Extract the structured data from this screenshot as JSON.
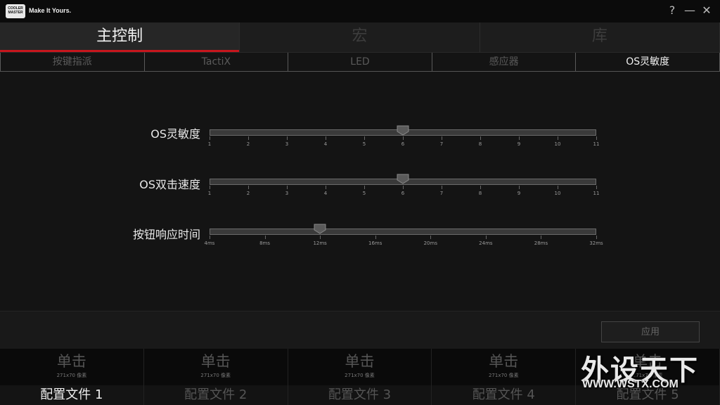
{
  "brand": {
    "logo_text": "COOLER MASTER",
    "tagline": "Make It Yours."
  },
  "window_controls": {
    "help": "?",
    "minimize": "—",
    "close": "✕"
  },
  "main_tabs": [
    {
      "label": "主控制",
      "active": true
    },
    {
      "label": "宏",
      "active": false
    },
    {
      "label": "库",
      "active": false
    }
  ],
  "sub_tabs": [
    {
      "label": "按键指派",
      "active": false
    },
    {
      "label": "TactiX",
      "active": false
    },
    {
      "label": "LED",
      "active": false
    },
    {
      "label": "感应器",
      "active": false
    },
    {
      "label": "OS灵敏度",
      "active": true
    }
  ],
  "sliders": [
    {
      "label": "OS灵敏度",
      "ticks": [
        "1",
        "2",
        "3",
        "4",
        "5",
        "6",
        "7",
        "8",
        "9",
        "10",
        "11"
      ],
      "value_index": 5
    },
    {
      "label": "OS双击速度",
      "ticks": [
        "1",
        "2",
        "3",
        "4",
        "5",
        "6",
        "7",
        "8",
        "9",
        "10",
        "11"
      ],
      "value_index": 5
    },
    {
      "label": "按钮响应时间",
      "ticks": [
        "4ms",
        "8ms",
        "12ms",
        "16ms",
        "20ms",
        "24ms",
        "28ms",
        "32ms"
      ],
      "value_index": 2
    }
  ],
  "apply_label": "应用",
  "profiles": [
    {
      "click_label": "单击",
      "resolution": "271x70 像素",
      "name": "配置文件 1",
      "active": true
    },
    {
      "click_label": "单击",
      "resolution": "271x70 像素",
      "name": "配置文件 2",
      "active": false
    },
    {
      "click_label": "单击",
      "resolution": "271x70 像素",
      "name": "配置文件 3",
      "active": false
    },
    {
      "click_label": "单击",
      "resolution": "271x70 像素",
      "name": "配置文件 4",
      "active": false
    },
    {
      "click_label": "单击",
      "resolution": "271x70 像素",
      "name": "配置文件 5",
      "active": false
    }
  ],
  "watermark": {
    "text": "外设天下",
    "url": "WWW.WSTX.COM"
  },
  "colors": {
    "accent": "#c8161d",
    "background": "#141414"
  }
}
